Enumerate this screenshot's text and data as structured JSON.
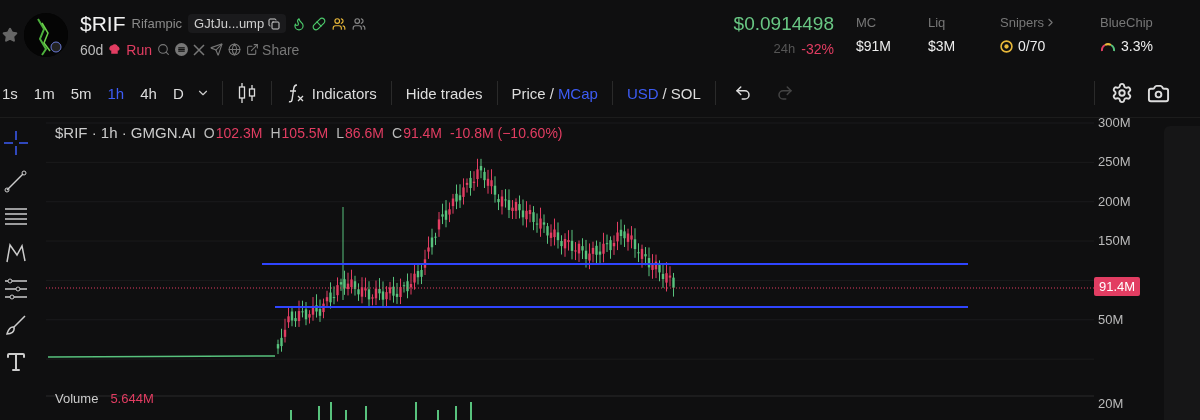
{
  "token": {
    "symbol": "$RIF",
    "name": "Rifampic",
    "address": "GJtJu...ump",
    "age": "60d",
    "run_label": "Run",
    "share": "Share"
  },
  "price": {
    "value": "$0.0914498",
    "period": "24h",
    "change": "-32%"
  },
  "stats": [
    {
      "kind": "plain",
      "label": "MC",
      "value": "$91M"
    },
    {
      "kind": "plain",
      "label": "Liq",
      "value": "$3M"
    },
    {
      "kind": "snipers",
      "label": "Snipers",
      "value": "0/70"
    },
    {
      "kind": "bluechip",
      "label": "BlueChip",
      "value": "3.3%"
    }
  ],
  "toolbar": {
    "intervals": [
      {
        "label": "1s",
        "selected": false
      },
      {
        "label": "1m",
        "selected": false
      },
      {
        "label": "5m",
        "selected": false
      },
      {
        "label": "1h",
        "selected": true
      },
      {
        "label": "4h",
        "selected": false
      },
      {
        "label": "D",
        "selected": false
      }
    ],
    "indicators": "Indicators",
    "hide_trades": "Hide trades",
    "price_mode": [
      {
        "label": "Price",
        "selected": false
      },
      {
        "label": "MCap",
        "selected": true
      }
    ],
    "currency": [
      {
        "label": "USD",
        "selected": true
      },
      {
        "label": "SOL",
        "selected": false
      }
    ],
    "price_separator": "/",
    "currency_separator": "/",
    "undo_disabled": false,
    "redo_disabled": true
  },
  "legend": {
    "title": "$RIF · 1h · GMGN.AI",
    "ohlc": [
      {
        "key": "O",
        "value": "102.3M"
      },
      {
        "key": "H",
        "value": "105.5M"
      },
      {
        "key": "L",
        "value": "86.6M"
      },
      {
        "key": "C",
        "value": "91.4M"
      }
    ],
    "change": "-10.8M (−10.60%)"
  },
  "price_axis": [
    "300M",
    "250M",
    "200M",
    "150M",
    "50M"
  ],
  "last_price": "91.4M",
  "volume": {
    "label": "Volume",
    "value": "5.644M",
    "axis": "20M"
  }
}
